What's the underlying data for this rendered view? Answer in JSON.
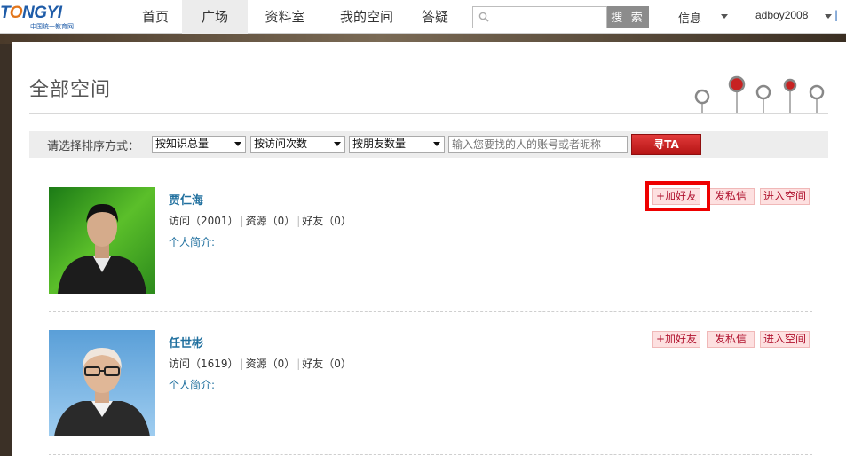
{
  "header": {
    "logo_text_main": "TONGYI",
    "logo_text_sub": "中国统一教育网",
    "nav": [
      "首页",
      "广场",
      "资料室",
      "我的空间",
      "答疑"
    ],
    "active_nav": "广场",
    "search_placeholder": "",
    "search_button": "搜 索",
    "messages_label": "信息",
    "username": "adboy2008",
    "more_link": "|"
  },
  "page": {
    "title": "全部空间"
  },
  "filter": {
    "label": "请选择排序方式：",
    "sort_knowledge": "按知识总量",
    "sort_visits": "按访问次数",
    "sort_friends": "按朋友数量",
    "search_placeholder": "输入您要找的人的账号或者昵称",
    "find_button": "寻TA"
  },
  "users": [
    {
      "name": "贾仁海",
      "visits_label": "访问（2001）",
      "resources_label": "资源（0）",
      "friends_label": "好友（0）",
      "bio_label": "个人简介:",
      "add_friend": "+加好友",
      "send_message": "发私信",
      "enter_space": "进入空间"
    },
    {
      "name": "任世彬",
      "visits_label": "访问（1619）",
      "resources_label": "资源（0）",
      "friends_label": "好友（0）",
      "bio_label": "个人简介:",
      "add_friend": "+加好友",
      "send_message": "发私信",
      "enter_space": "进入空间"
    }
  ],
  "colors": {
    "accent_red": "#ee0000",
    "link_blue": "#1f6f9e",
    "pink_button_bg": "#fde0e0"
  }
}
